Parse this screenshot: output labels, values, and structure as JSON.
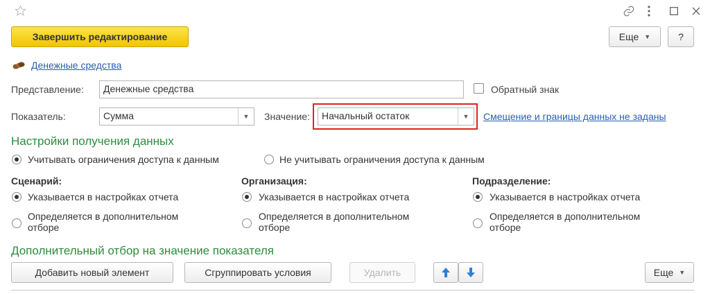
{
  "window": {
    "star_icon": "star-outline",
    "link_icon": "chain-link",
    "more_icon": "vertical-dots",
    "maximize_icon": "square",
    "close_icon": "x"
  },
  "toolbar": {
    "finish_label": "Завершить редактирование",
    "more_label": "Еще",
    "help_label": "?"
  },
  "breadcrumb_link": "Денежные средства",
  "representation": {
    "label": "Представление:",
    "value": "Денежные средства",
    "inverse_sign_label": "Обратный знак",
    "inverse_sign_checked": false
  },
  "indicator": {
    "label": "Показатель:",
    "value": "Сумма",
    "value_label": "Значение:",
    "value_value": "Начальный остаток",
    "offset_link": "Смещение и границы данных не заданы"
  },
  "data_settings": {
    "title": "Настройки получения данных",
    "access_options": [
      "Учитывать ограничения доступа к данным",
      "Не  учитывать ограничения доступа к данным"
    ],
    "access_selected": 0
  },
  "columns": [
    {
      "title": "Сценарий:",
      "opt1": "Указывается в настройках отчета",
      "opt2_line1": "Определяется в дополнительном",
      "opt2_line2": "отборе"
    },
    {
      "title": "Организация:",
      "opt1": "Указывается в настройках отчета",
      "opt2_line1": "Определяется в дополнительном",
      "opt2_line2": "отборе"
    },
    {
      "title": "Подразделение:",
      "opt1": "Указывается в настройках отчета",
      "opt2_line1": "Определяется в дополнительном",
      "opt2_line2": "отборе"
    }
  ],
  "filter_section": {
    "title": "Дополнительный отбор на значение показателя",
    "add_label": "Добавить новый элемент",
    "group_label": "Сгруппировать условия",
    "delete_label": "Удалить",
    "more_label": "Еще"
  },
  "colors": {
    "accent_green": "#2e8b3f",
    "primary_yellow": "#f5d000",
    "highlight_red": "#e02020",
    "link_blue": "#2a5db0",
    "arrow_blue": "#2f7fd6"
  }
}
